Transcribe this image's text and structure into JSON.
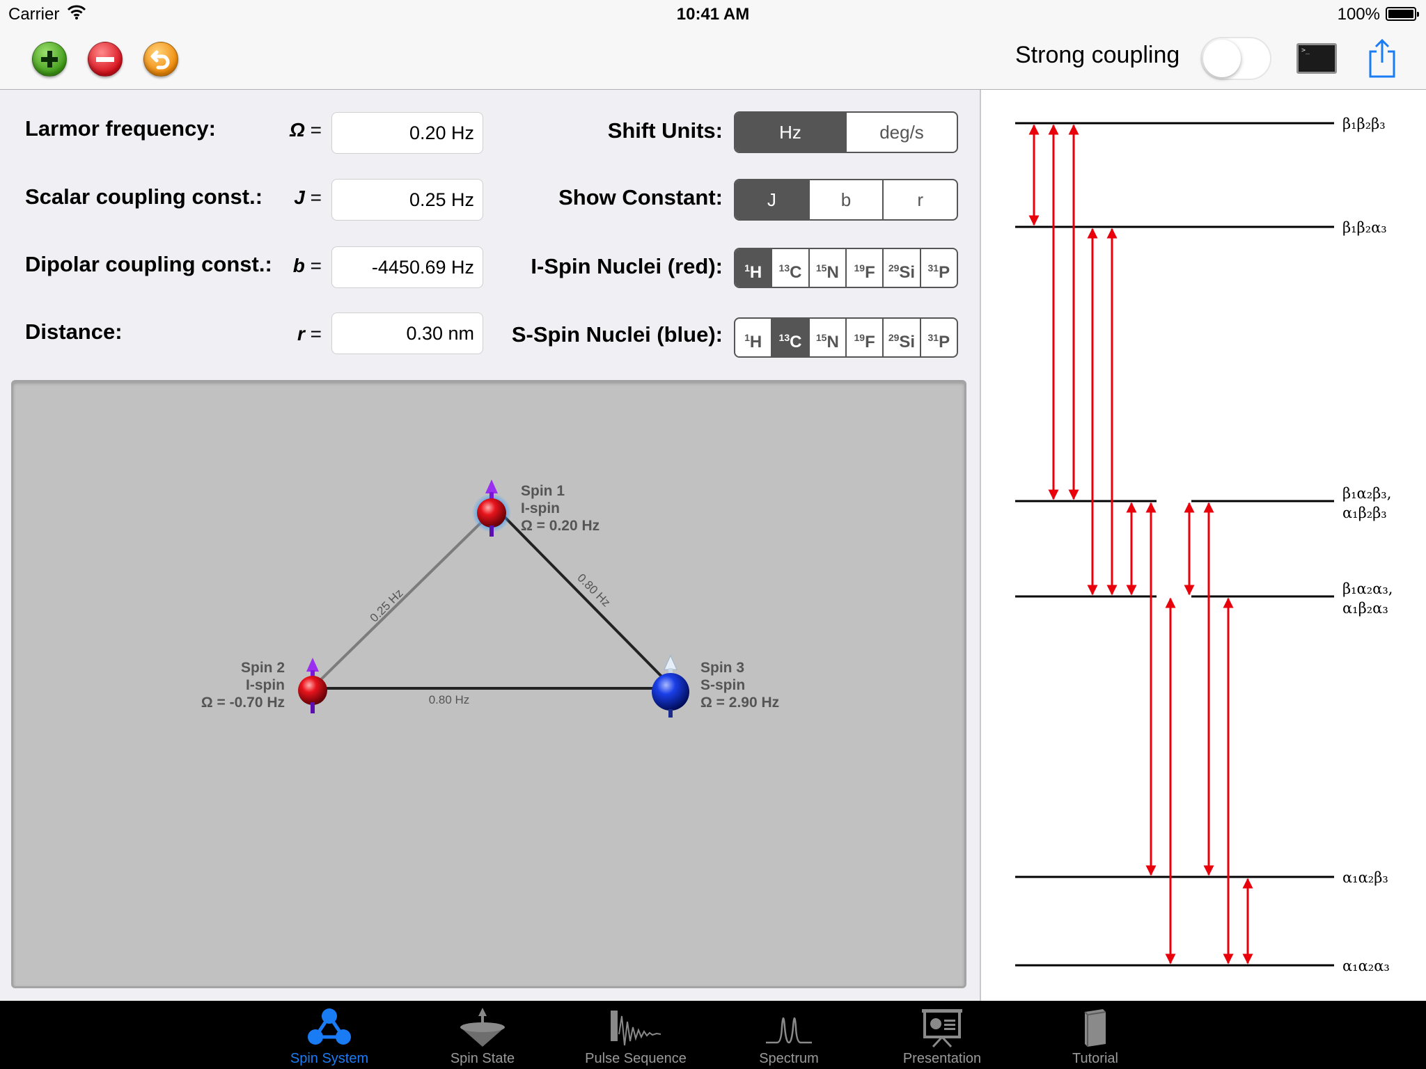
{
  "status_bar": {
    "carrier": "Carrier",
    "time": "10:41 AM",
    "battery": "100%"
  },
  "toolbar": {
    "strong_coupling_label": "Strong coupling",
    "strong_coupling_on": false,
    "terminal_icon_text": ">_"
  },
  "params": {
    "larmor": {
      "label": "Larmor frequency:",
      "symbol": "Ω",
      "value": "0.20 Hz"
    },
    "scalar": {
      "label": "Scalar coupling const.:",
      "symbol": "J",
      "value": "0.25 Hz"
    },
    "dipolar": {
      "label": "Dipolar coupling const.:",
      "symbol": "b",
      "value": "-4450.69 Hz"
    },
    "distance": {
      "label": "Distance:",
      "symbol": "r",
      "value": "0.30 nm"
    },
    "equals": "="
  },
  "settings": {
    "shift_units": {
      "label": "Shift Units:",
      "options": [
        "Hz",
        "deg/s"
      ],
      "selected": 0
    },
    "show_constant": {
      "label": "Show Constant:",
      "options": [
        "J",
        "b",
        "r"
      ],
      "selected": 0
    },
    "i_spin": {
      "label": "I-Spin Nuclei (red):",
      "selected": 0
    },
    "s_spin": {
      "label": "S-Spin Nuclei (blue):",
      "selected": 1
    },
    "nuclei": [
      {
        "mass": "1",
        "el": "H"
      },
      {
        "mass": "13",
        "el": "C"
      },
      {
        "mass": "15",
        "el": "N"
      },
      {
        "mass": "19",
        "el": "F"
      },
      {
        "mass": "29",
        "el": "Si"
      },
      {
        "mass": "31",
        "el": "P"
      }
    ]
  },
  "molecule": {
    "spins": [
      {
        "name": "Spin 1",
        "type": "I-spin",
        "omega": "Ω = 0.20 Hz",
        "color": "#e0141c"
      },
      {
        "name": "Spin 2",
        "type": "I-spin",
        "omega": "Ω = -0.70 Hz",
        "color": "#e0141c"
      },
      {
        "name": "Spin 3",
        "type": "S-spin",
        "omega": "Ω = 2.90 Hz",
        "color": "#1a3fe8"
      }
    ],
    "couplings": [
      "0.25 Hz",
      "0.80 Hz",
      "0.80 Hz"
    ]
  },
  "energy_levels": [
    {
      "label": "β₁β₂β₃"
    },
    {
      "label": "β₁β₂α₃"
    },
    {
      "label": "β₁α₂β₃,",
      "label2": "α₁β₂β₃"
    },
    {
      "label": "β₁α₂α₃,",
      "label2": "α₁β₂α₃"
    },
    {
      "label": "α₁α₂β₃"
    },
    {
      "label": "α₁α₂α₃"
    }
  ],
  "transition_color": "#e8000b",
  "tabs": [
    {
      "label": "Spin System",
      "icon": "spin-system-icon",
      "active": true
    },
    {
      "label": "Spin State",
      "icon": "spin-state-icon",
      "active": false
    },
    {
      "label": "Pulse Sequence",
      "icon": "pulse-sequence-icon",
      "active": false
    },
    {
      "label": "Spectrum",
      "icon": "spectrum-icon",
      "active": false
    },
    {
      "label": "Presentation",
      "icon": "presentation-icon",
      "active": false
    },
    {
      "label": "Tutorial",
      "icon": "tutorial-icon",
      "active": false
    }
  ],
  "colors": {
    "active_tab": "#1a7cf5",
    "segment_selected": "#555555"
  }
}
